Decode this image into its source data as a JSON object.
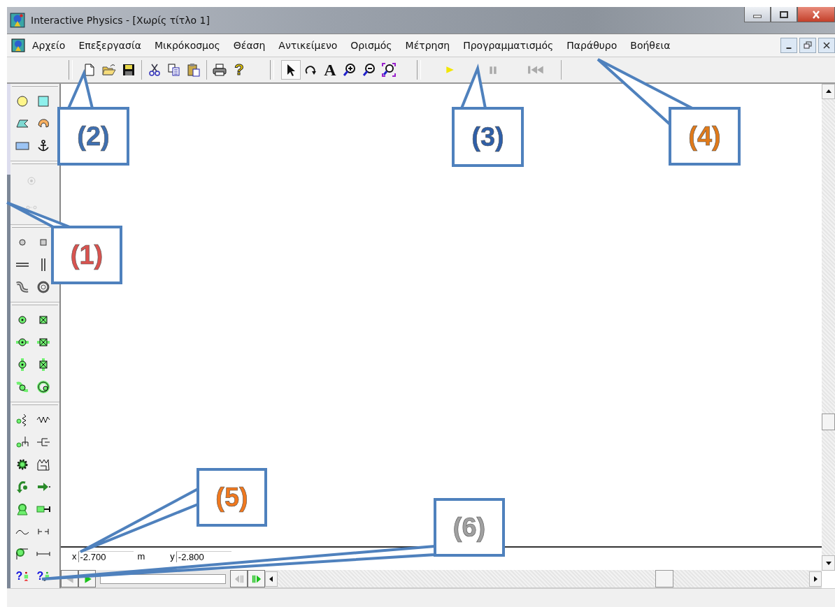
{
  "window": {
    "title": "Interactive Physics - [Χωρίς τίτλο 1]"
  },
  "menu": [
    {
      "label": "Αρχείο"
    },
    {
      "label": "Επεξεργασία"
    },
    {
      "label": "Μικρόκοσμος"
    },
    {
      "label": "Θέαση"
    },
    {
      "label": "Αντικείμενο"
    },
    {
      "label": "Ορισμός"
    },
    {
      "label": "Μέτρηση"
    },
    {
      "label": "Προγραμματισμός"
    },
    {
      "label": "Παράθυρο"
    },
    {
      "label": "Βοήθεια"
    }
  ],
  "toolbar": {
    "text_tool": "A",
    "help": "?"
  },
  "toolbox": {
    "groups": [
      {
        "disabled": false
      },
      {
        "disabled": true
      },
      {
        "disabled": false
      },
      {
        "disabled": false
      },
      {
        "disabled": false
      }
    ],
    "query_marks": [
      "?",
      "?"
    ]
  },
  "coordinates": {
    "x_label": "x",
    "x_value": "-2.700",
    "unit": "m",
    "y_label": "y",
    "y_value": "-2.800"
  },
  "callouts": [
    {
      "label": "(1)",
      "color": "#d9534f"
    },
    {
      "label": "(2)",
      "color": "#3f6fb0"
    },
    {
      "label": "(3)",
      "color": "#2f5fa8"
    },
    {
      "label": "(4)",
      "color": "#e07a1a"
    },
    {
      "label": "(5)",
      "color": "#f0781e"
    },
    {
      "label": "(6)",
      "color": "#a0a0a0"
    }
  ]
}
